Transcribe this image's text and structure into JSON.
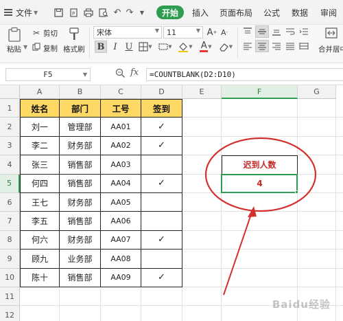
{
  "menubar": {
    "file_label": "文件",
    "tabs": [
      "开始",
      "插入",
      "页面布局",
      "公式",
      "数据",
      "审阅"
    ]
  },
  "ribbon": {
    "paste_label": "粘贴",
    "cut_label": "剪切",
    "copy_label": "复制",
    "format_painter_label": "格式刷",
    "font_name": "宋体",
    "font_size": "11",
    "merge_label": "合并居中"
  },
  "formula_bar": {
    "name_box": "F5",
    "fx_label": "fx",
    "formula": "=COUNTBLANK(D2:D10)"
  },
  "columns": [
    "A",
    "B",
    "C",
    "D",
    "E",
    "F",
    "G"
  ],
  "rows": [
    "1",
    "2",
    "3",
    "4",
    "5",
    "6",
    "7",
    "8",
    "9",
    "10",
    "11",
    "12"
  ],
  "table": {
    "headers": [
      "姓名",
      "部门",
      "工号",
      "签到"
    ],
    "rows": [
      [
        "刘一",
        "管理部",
        "AA01",
        "✓"
      ],
      [
        "李二",
        "财务部",
        "AA02",
        "✓"
      ],
      [
        "张三",
        "销售部",
        "AA03",
        ""
      ],
      [
        "何四",
        "销售部",
        "AA04",
        "✓"
      ],
      [
        "王七",
        "财务部",
        "AA05",
        ""
      ],
      [
        "李五",
        "销售部",
        "AA06",
        ""
      ],
      [
        "何六",
        "财务部",
        "AA07",
        "✓"
      ],
      [
        "顾九",
        "业务部",
        "AA08",
        ""
      ],
      [
        "陈十",
        "销售部",
        "AA09",
        "✓"
      ]
    ]
  },
  "result": {
    "label": "迟到人数",
    "value": "4"
  },
  "watermark": "Baidu经验",
  "colors": {
    "accent": "#2e9d4f",
    "header_fill": "#ffd965",
    "annotation_red": "#d32f2f",
    "result_text": "#c62828"
  }
}
